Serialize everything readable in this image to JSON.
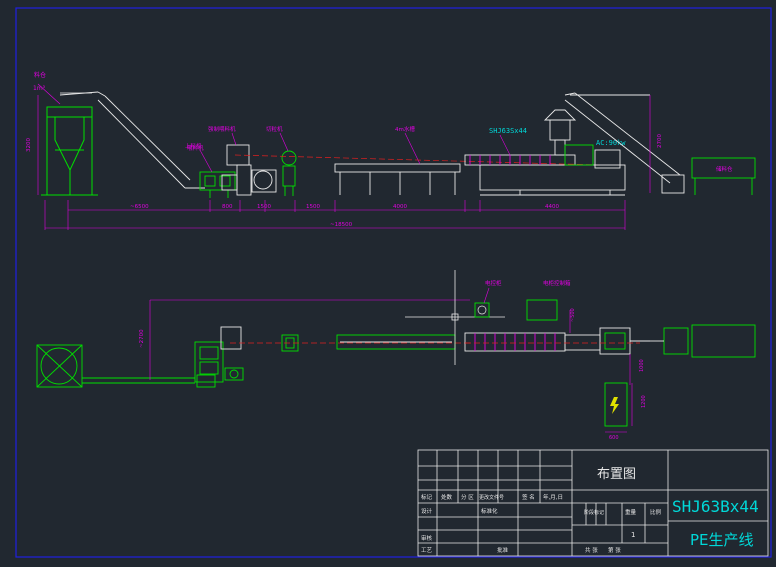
{
  "title_block": {
    "drawing_title": "布置图",
    "model": "SHJ63Bx44",
    "line_name": "PE生产线",
    "row_labels": [
      "标记",
      "处数",
      "分 区",
      "更改文件号",
      "签 名",
      "年,月,日"
    ],
    "left_labels": [
      "设计",
      "标准化",
      "审核",
      "工艺",
      "批准"
    ],
    "stage_labels": [
      "阶段标记",
      "重量",
      "比例"
    ],
    "scale": "1",
    "sheet_labels": [
      "共 张",
      "第 张"
    ]
  },
  "elevation": {
    "hopper_label": "料仓",
    "hopper_volume": "1m³",
    "conveyor_label": "上料机",
    "mixer_label": "喂料机",
    "shredder_label": "强制喂料机",
    "cutter_label": "切粒机",
    "water_tank_label": "4m水槽",
    "extruder_label": "SHJ63Sx44",
    "motor_label": "AC:90kw",
    "silo_label": "储料仓",
    "dim_height_left": "3200",
    "dim_height_right": "2700",
    "dim_6500": "~6500",
    "dim_800": "800",
    "dim_1500a": "1500",
    "dim_1500b": "1500",
    "dim_4000": "4000",
    "dim_4400": "4400",
    "dim_total": "~18500"
  },
  "plan": {
    "control_label": "电控柜",
    "cabinet_label": "电柜控制箱",
    "dim_2700": "~2700",
    "dim_500": "~500",
    "dim_1000": "1000",
    "dim_1200": "1200",
    "dim_600": "600"
  },
  "colors": {
    "frame": "#1d1de0",
    "green": "#00e000",
    "white": "#e8e8e8",
    "magenta": "#e000e0",
    "cyan": "#00d8d8",
    "red": "#e02020",
    "yellow": "#e0e000"
  }
}
